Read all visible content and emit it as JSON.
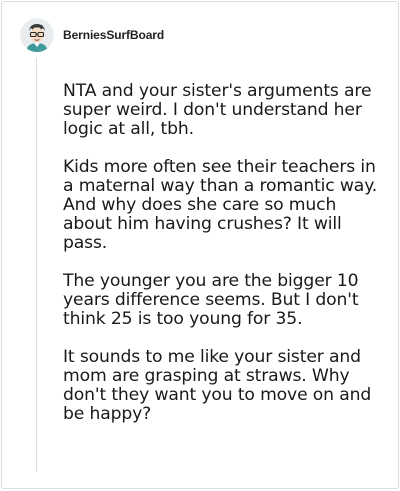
{
  "comment": {
    "username": "BerniesSurfBoard",
    "avatar_icon": "cartoon-avatar-icon",
    "paragraphs": [
      "NTA and your sister's arguments are super weird. I don't understand her logic at all, tbh.",
      "Kids more often see their teachers in a maternal way than a romantic way. And why does she care so much about him having crushes? It will pass.",
      "The younger you are the bigger 10 years difference seems. But I don't think 25 is too young for 35.",
      "It sounds to me like your sister and mom are grasping at straws. Why don't they want you to move on and be happy?"
    ]
  }
}
